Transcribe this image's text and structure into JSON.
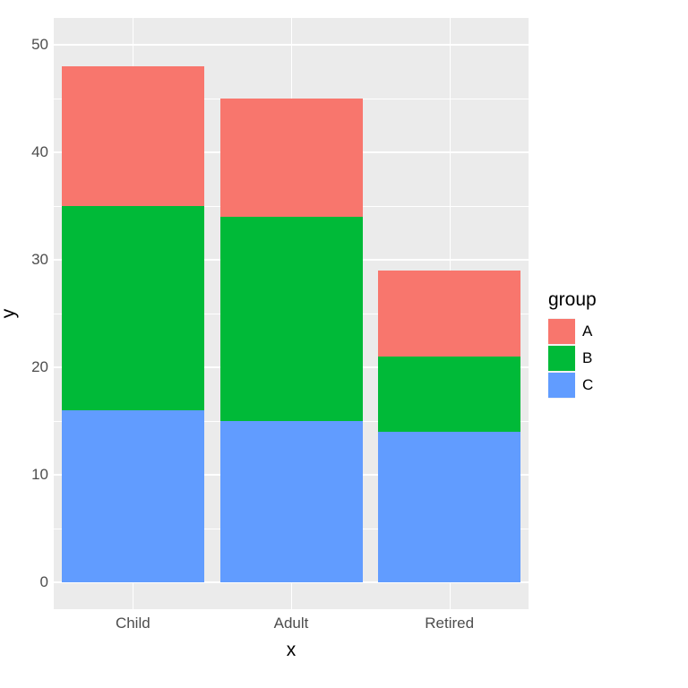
{
  "chart_data": {
    "type": "bar",
    "stacked": true,
    "categories": [
      "Child",
      "Adult",
      "Retired"
    ],
    "series": [
      {
        "name": "A",
        "values": [
          13,
          11,
          8
        ],
        "color": "#f8766d"
      },
      {
        "name": "B",
        "values": [
          19,
          19,
          7
        ],
        "color": "#00ba38"
      },
      {
        "name": "C",
        "values": [
          16,
          15,
          14
        ],
        "color": "#619cff"
      }
    ],
    "stack_order": [
      "C",
      "B",
      "A"
    ],
    "totals": [
      48,
      45,
      29
    ],
    "xlabel": "x",
    "ylabel": "y",
    "ylim": [
      0,
      50
    ],
    "y_ticks": [
      0,
      10,
      20,
      30,
      40,
      50
    ],
    "y_minor_ticks": [
      5,
      15,
      25,
      35,
      45
    ],
    "legend_title": "group",
    "legend_order": [
      "A",
      "B",
      "C"
    ]
  }
}
